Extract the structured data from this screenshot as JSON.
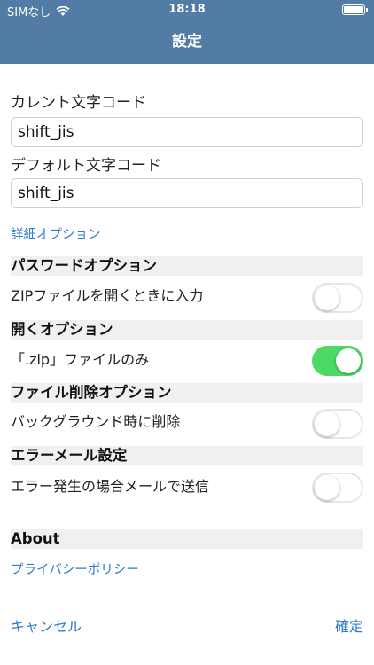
{
  "status": {
    "carrier": "SIMなし",
    "time": "18:18"
  },
  "nav": {
    "title": "設定"
  },
  "form": {
    "current_label": "カレント文字コード",
    "current_value": "shift_jis",
    "default_label": "デフォルト文字コード",
    "default_value": "shift_jis",
    "details_link": "詳細オプション"
  },
  "sections": [
    {
      "header": "パスワードオプション",
      "row_label": "ZIPファイルを開くときに入力",
      "on": false
    },
    {
      "header": "開くオプション",
      "row_label": "「.zip」ファイルのみ",
      "on": true
    },
    {
      "header": "ファイル削除オプション",
      "row_label": "バックグラウンド時に削除",
      "on": false
    },
    {
      "header": "エラーメール設定",
      "row_label": "エラー発生の場合メールで送信",
      "on": false
    }
  ],
  "about": {
    "header": "About",
    "privacy_link": "プライバシーポリシー"
  },
  "footer": {
    "cancel": "キャンセル",
    "confirm": "確定"
  },
  "colors": {
    "nav": "#527ba6",
    "link": "#2f7bcf",
    "toggle_on": "#4cd964"
  }
}
